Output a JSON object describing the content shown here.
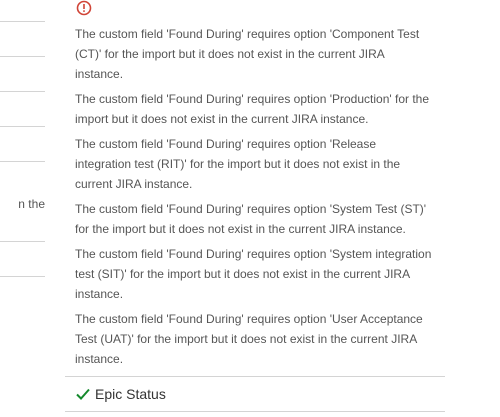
{
  "left_column": {
    "partial_text": "n the"
  },
  "errors": [
    "The custom field 'Found During' requires option 'Component Test (CT)' for the import but it does not exist in the current JIRA instance.",
    "The custom field 'Found During' requires option 'Production' for the import but it does not exist in the current JIRA instance.",
    "The custom field 'Found During' requires option 'Release integration test (RIT)' for the import but it does not exist in the current JIRA instance.",
    "The custom field 'Found During' requires option 'System Test (ST)' for the import but it does not exist in the current JIRA instance.",
    "The custom field 'Found During' requires option 'System integration test (SIT)' for the import but it does not exist in the current JIRA instance.",
    "The custom field 'Found During' requires option 'User Acceptance Test (UAT)' for the import but it does not exist in the current JIRA instance."
  ],
  "field_row": {
    "label": "Epic Status",
    "status_icon": "check-icon"
  },
  "colors": {
    "error": "#d04437",
    "success": "#14892c",
    "text": "#555555",
    "divider": "#d4d4d4"
  }
}
